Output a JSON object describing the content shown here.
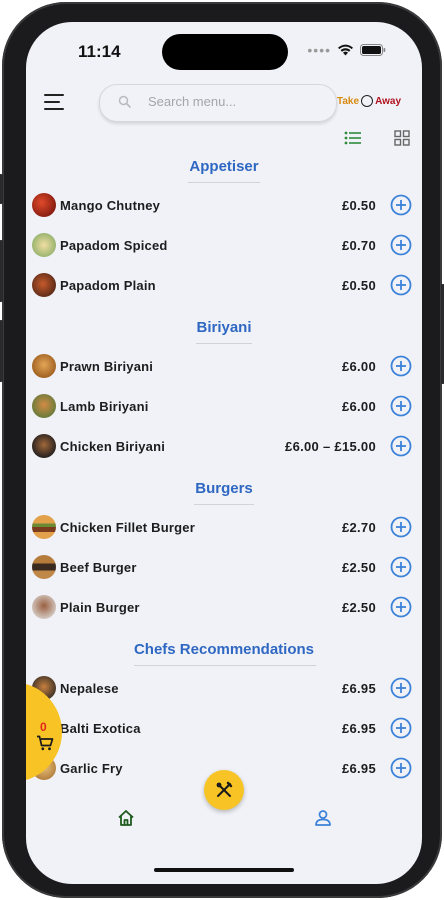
{
  "status_bar": {
    "time": "11:14"
  },
  "search": {
    "placeholder": "Search menu..."
  },
  "brand": {
    "left": "Take",
    "right": "Away",
    "colors": {
      "take": "#d88b11",
      "away": "#b0121e"
    }
  },
  "colors": {
    "accent": "#2f68c3",
    "add": "#3b82d8",
    "cart": "#f7c325",
    "cart_count": "#e0261b",
    "active_nav": "#1e5a1e",
    "list_view_active": "#2e8b3a"
  },
  "sections": [
    {
      "title": "Appetiser",
      "items": [
        {
          "name": "Mango Chutney",
          "price": "£0.50"
        },
        {
          "name": "Papadom Spiced",
          "price": "£0.70"
        },
        {
          "name": "Papadom Plain",
          "price": "£0.50"
        }
      ]
    },
    {
      "title": "Biriyani",
      "items": [
        {
          "name": "Prawn Biriyani",
          "price": "£6.00"
        },
        {
          "name": "Lamb Biriyani",
          "price": "£6.00"
        },
        {
          "name": "Chicken Biriyani",
          "price": "£6.00 – £15.00"
        }
      ]
    },
    {
      "title": "Burgers",
      "items": [
        {
          "name": "Chicken Fillet Burger",
          "price": "£2.70"
        },
        {
          "name": "Beef Burger",
          "price": "£2.50"
        },
        {
          "name": "Plain Burger",
          "price": "£2.50"
        }
      ]
    },
    {
      "title": "Chefs Recommendations",
      "items": [
        {
          "name": "Nepalese",
          "price": "£6.95"
        },
        {
          "name": "Balti Exotica",
          "price": "£6.95"
        },
        {
          "name": "Garlic Fry",
          "price": "£6.95"
        }
      ]
    }
  ],
  "cart": {
    "count": "0"
  },
  "icons": {
    "menu": "hamburger-menu-icon",
    "search": "search-icon",
    "list": "list-view-icon",
    "grid": "grid-view-icon",
    "add": "add-circle-icon",
    "cart": "cart-icon",
    "fab": "cutlery-icon",
    "home": "home-icon",
    "user": "user-icon"
  }
}
